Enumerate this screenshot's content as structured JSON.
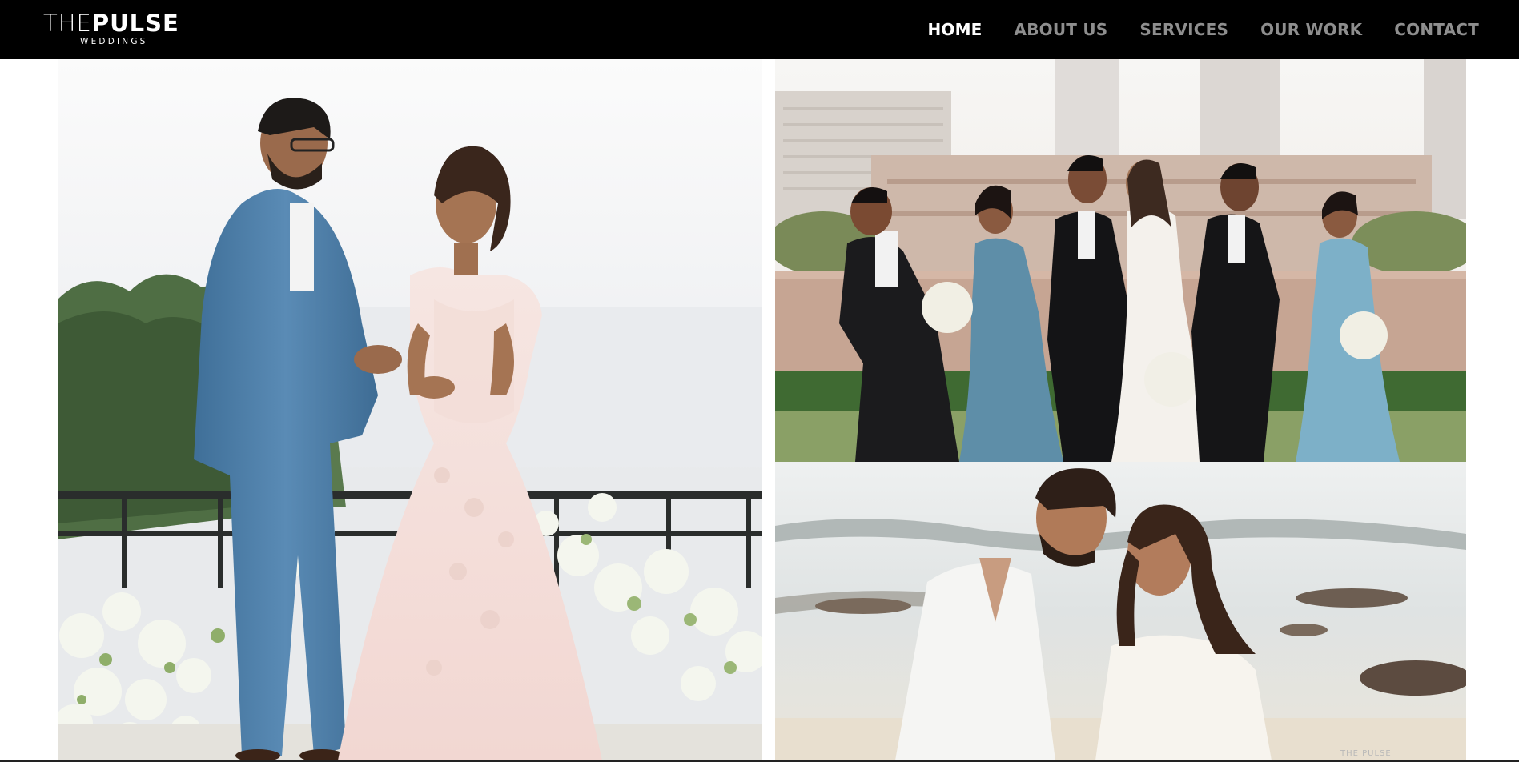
{
  "brand": {
    "name_light": "THE",
    "name_bold": "PULSE",
    "tagline": "WEDDINGS"
  },
  "nav": {
    "items": [
      {
        "label": "HOME",
        "active": true
      },
      {
        "label": "ABOUT US",
        "active": false
      },
      {
        "label": "SERVICES",
        "active": false
      },
      {
        "label": "OUR WORK",
        "active": false
      },
      {
        "label": "CONTACT",
        "active": false
      }
    ]
  },
  "gallery": {
    "watermark": "THE PULSE"
  },
  "colors": {
    "nav_bg": "#000000",
    "nav_active": "#ffffff",
    "nav_inactive": "#8e8e8e"
  }
}
